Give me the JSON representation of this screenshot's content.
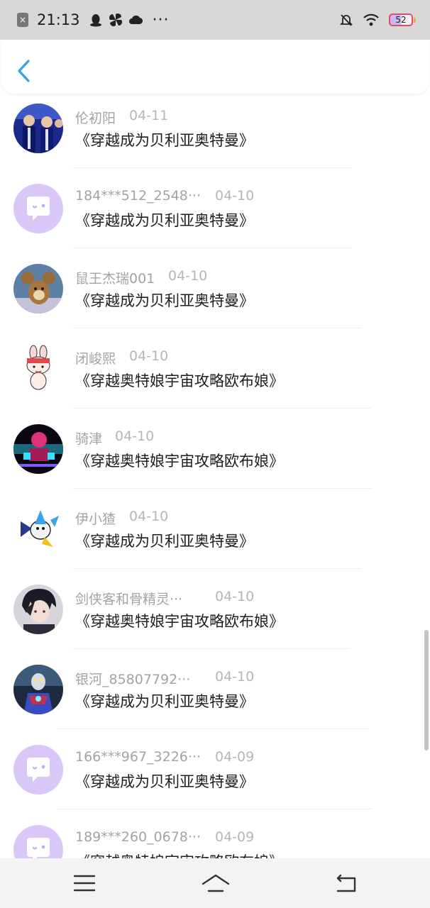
{
  "status_bar": {
    "time": "21:13",
    "more": "···",
    "battery_level": "52",
    "icons": [
      "close-box-icon",
      "qq-penguin-icon",
      "pinwheel-icon",
      "cloud-icon",
      "bell-off-icon",
      "wifi-icon",
      "battery-icon"
    ]
  },
  "header": {
    "back_icon": "chevron-left-icon",
    "accent_color": "#3aa0e8"
  },
  "comments": [
    {
      "username": "伦初阳",
      "date": "04-11",
      "title": "《穿越成为贝利亚奥特曼》",
      "avatar": "photo-group-blue"
    },
    {
      "username": "184***512_2548···",
      "date": "04-10",
      "title": "《穿越成为贝利亚奥特曼》",
      "avatar": "default-chat"
    },
    {
      "username": "鼠王杰瑞001",
      "date": "04-10",
      "title": "《穿越成为贝利亚奥特曼》",
      "avatar": "cartoon-mouse"
    },
    {
      "username": "闭峻熙",
      "date": "04-10",
      "title": "《穿越奥特娘宇宙攻略欧布娘》",
      "avatar": "cartoon-rabbit"
    },
    {
      "username": "骑津",
      "date": "04-10",
      "title": "《穿越奥特娘宇宙攻略欧布娘》",
      "avatar": "neon-figure"
    },
    {
      "username": "伊小猹",
      "date": "04-10",
      "title": "《穿越成为贝利亚奥特曼》",
      "avatar": "digital-creature"
    },
    {
      "username": "剑侠客和骨精灵···",
      "date": "04-10",
      "title": "《穿越奥特娘宇宙攻略欧布娘》",
      "avatar": "anime-boy"
    },
    {
      "username": "银河_85807792···",
      "date": "04-10",
      "title": "《穿越成为贝利亚奥特曼》",
      "avatar": "ultraman-hero"
    },
    {
      "username": "166***967_3226···",
      "date": "04-09",
      "title": "《穿越成为贝利亚奥特曼》",
      "avatar": "default-chat"
    },
    {
      "username": "189***260_0678···",
      "date": "04-09",
      "title": "《穿越奥特娘宇宙攻略欧布娘》",
      "avatar": "default-chat"
    }
  ],
  "nav_bar": {
    "buttons": [
      "menu-icon",
      "home-icon",
      "back-icon"
    ]
  },
  "colors": {
    "default_avatar": "#d9c8f7",
    "username": "#a3a3a3",
    "title": "#1e1e1e",
    "status_bar_bg": "#d8d8d8"
  }
}
